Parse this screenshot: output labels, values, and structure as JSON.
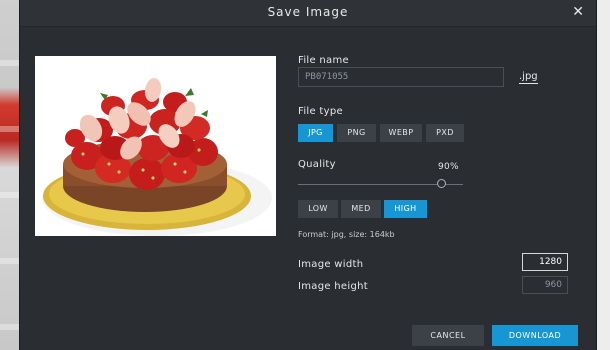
{
  "dialog": {
    "title": "Save Image",
    "close_glyph": "✕"
  },
  "preview": {
    "alt": "strawberry tart photo"
  },
  "file_name": {
    "label": "File name",
    "value": "PB071055",
    "extension": ".jpg"
  },
  "file_type": {
    "label": "File type",
    "options": [
      "JPG",
      "PNG",
      "WEBP",
      "PXD"
    ],
    "selected": "JPG"
  },
  "quality": {
    "label": "Quality",
    "value_text": "90%",
    "value": 0.9,
    "presets": [
      "LOW",
      "MED",
      "HIGH"
    ],
    "selected_preset": "HIGH"
  },
  "format_info": "Format: jpg, size: 164kb",
  "image_width": {
    "label": "Image width",
    "value": "1280"
  },
  "image_height": {
    "label": "Image height",
    "value": "960"
  },
  "buttons": {
    "cancel": "CANCEL",
    "download": "DOWNLOAD"
  },
  "colors": {
    "accent": "#1896d3",
    "panel": "#2a2e33"
  }
}
